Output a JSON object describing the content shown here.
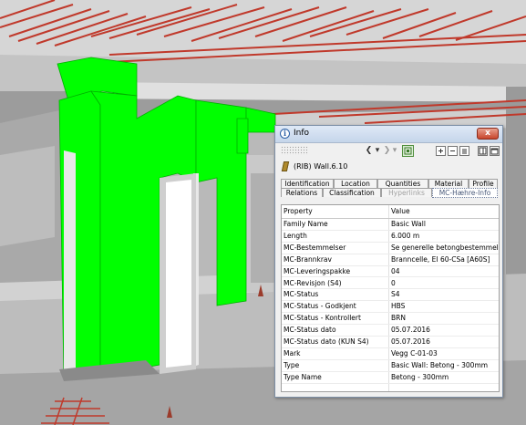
{
  "window": {
    "title": "Info",
    "info_icon": "info-icon",
    "close_label": "x"
  },
  "toolbar": {
    "back_icon": "back-arrow-icon",
    "dropdown_icon": "chevron-down-icon",
    "forward_icon": "forward-arrow-icon",
    "back_glyph": "❮",
    "forward_glyph": "❯",
    "dropdown_glyph": "▾",
    "refresh_icon": "refresh-icon",
    "expand_icon": "expand-all-icon",
    "collapse_icon": "collapse-all-icon",
    "list_icon": "list-view-icon",
    "dock_icon": "dock-icon",
    "float_icon": "float-icon"
  },
  "element": {
    "label": "(RIB) Wall.6.10",
    "icon": "wall-icon"
  },
  "tabs": {
    "row1": [
      "Identification",
      "Location",
      "Quantities",
      "Material",
      "Profile"
    ],
    "row2": [
      "Relations",
      "Classification",
      "Hyperlinks",
      "MC-Hæhre-Info"
    ],
    "selected": "MC-Hæhre-Info",
    "disabled": "Hyperlinks"
  },
  "grid": {
    "header_property": "Property",
    "header_value": "Value",
    "rows": [
      {
        "property": "Family Name",
        "value": "Basic Wall"
      },
      {
        "property": "Length",
        "value": "6.000 m"
      },
      {
        "property": "MC-Bestemmelser",
        "value": "Se generelle betongbestemmelser"
      },
      {
        "property": "MC-Brannkrav",
        "value": "Branncelle, EI 60-CSa [A60S]"
      },
      {
        "property": "MC-Leveringspakke",
        "value": "04"
      },
      {
        "property": "MC-Revisjon (S4)",
        "value": "0"
      },
      {
        "property": "MC-Status",
        "value": "S4"
      },
      {
        "property": "MC-Status - Godkjent",
        "value": "HBS"
      },
      {
        "property": "MC-Status - Kontrollert",
        "value": "BRN"
      },
      {
        "property": "MC-Status dato",
        "value": "05.07.2016"
      },
      {
        "property": "MC-Status dato (KUN S4)",
        "value": "05.07.2016"
      },
      {
        "property": "Mark",
        "value": "Vegg C-01-03"
      },
      {
        "property": "Type",
        "value": "Basic Wall: Betong - 300mm"
      },
      {
        "property": "Type Name",
        "value": "Betong - 300mm"
      }
    ]
  },
  "colors": {
    "selected_wall": "#00ff00",
    "rebar": "#c0392b",
    "concrete": "#c8c8c8"
  }
}
